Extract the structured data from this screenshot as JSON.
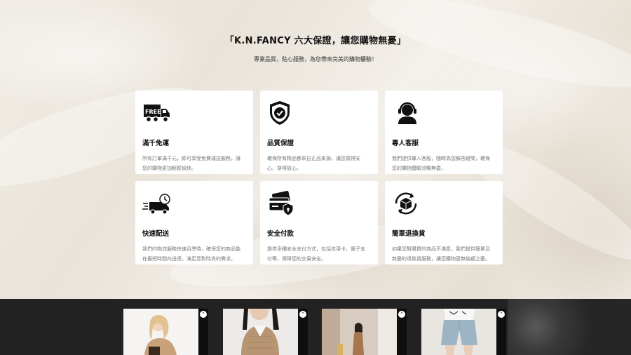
{
  "section": {
    "title": "「K.N.FANCY 六大保證，讓您購物無憂」",
    "subtitle": "專業品質，貼心服務，為您帶來完美的購物體驗！"
  },
  "features": [
    {
      "icon": "free-shipping-truck-icon",
      "title": "滿千免運",
      "desc_line1": "所有訂單滿千元，即可享受免費運送服務，讓",
      "desc_line2": "您的購物更加輕鬆愉快。"
    },
    {
      "icon": "quality-badge-icon",
      "title": "品質保證",
      "desc_line1": "確保所有精品都來自正品來源，讓您買得安",
      "desc_line2": "心、穿得放心。"
    },
    {
      "icon": "customer-service-headset-icon",
      "title": "專人客服",
      "desc_line1": "我們提供專人客服，隨時為您解答疑問，確保",
      "desc_line2": "您的購物體驗流暢無憂。"
    },
    {
      "icon": "fast-delivery-truck-icon",
      "title": "快速配送",
      "desc_line1": "我們的物流服務快速且準時，確保您的商品能",
      "desc_line2": "在最短時間內送達，滿足您對時尚的需求。"
    },
    {
      "icon": "secure-payment-card-icon",
      "title": "安全付款",
      "desc_line1": "提供多種安全支付方式，包括信用卡、電子支",
      "desc_line2": "付等，保障您的交易安全。"
    },
    {
      "icon": "easy-return-box-icon",
      "title": "簡單退換貨",
      "desc_line1": "如果您對購買的商品不滿意，我們提供簡單且",
      "desc_line2": "無憂的退換貨服務，讓您購物更無後顧之憂。"
    }
  ],
  "carousel": {
    "tiles": [
      {
        "name": "product-photo-1",
        "chevron": "⌃"
      },
      {
        "name": "product-photo-2",
        "chevron": "⌃"
      },
      {
        "name": "product-photo-3",
        "chevron": "⌃"
      },
      {
        "name": "product-photo-4",
        "chevron": "⌃"
      }
    ]
  }
}
